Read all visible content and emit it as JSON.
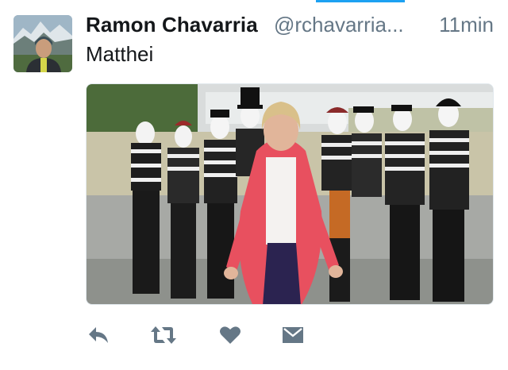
{
  "tweet": {
    "author": {
      "display_name": "Ramon Chavarria",
      "username": "@rchavarria..."
    },
    "timestamp": "11min",
    "text": "Matthei"
  },
  "icons": {
    "reply": "reply-icon",
    "retweet": "retweet-icon",
    "like": "heart-icon",
    "message": "envelope-icon"
  },
  "colors": {
    "accent": "#1da1f2",
    "action_icon": "#657786",
    "secondary_text": "#657786",
    "primary_text": "#14171a"
  }
}
